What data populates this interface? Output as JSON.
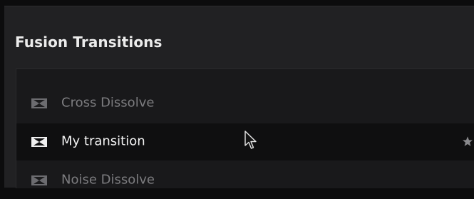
{
  "section": {
    "title": "Fusion Transitions"
  },
  "list": {
    "items": [
      {
        "label": "Cross Dissolve",
        "icon": "transition-icon",
        "selected": false
      },
      {
        "label": "My transition",
        "icon": "transition-icon",
        "selected": true,
        "trailing_icon": "star-icon"
      },
      {
        "label": "Noise Dissolve",
        "icon": "transition-icon",
        "selected": false
      }
    ]
  },
  "colors": {
    "background": "#0c0c0d",
    "panel": "#212123",
    "list_background": "#19191b",
    "selected_row": "#0f0f10",
    "label_muted": "#7d7d80",
    "label_selected": "#f2f2f2"
  },
  "cursor": {
    "icon": "arrow-cursor-icon"
  }
}
